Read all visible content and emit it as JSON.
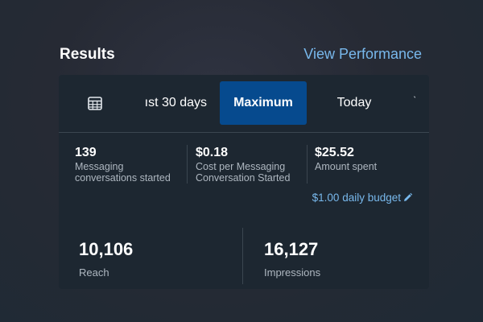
{
  "header": {
    "title": "Results",
    "link_label": "View Performance"
  },
  "tabs": {
    "calendar_icon": "calendar-icon",
    "items": [
      {
        "label": "ıst 30 days"
      },
      {
        "label": "Maximum",
        "selected": true
      },
      {
        "label": "Today"
      }
    ],
    "more_glyph": "ˋ"
  },
  "metrics": [
    {
      "value": "139",
      "label_line1": "Messaging",
      "label_line2": "conversations started"
    },
    {
      "value": "$0.18",
      "label_line1": "Cost per Messaging",
      "label_line2": "Conversation Started"
    },
    {
      "value": "$25.52",
      "label_line1": "Amount spent",
      "label_line2": ""
    }
  ],
  "budget": {
    "label": "$1.00 daily budget",
    "icon": "pencil-icon"
  },
  "big_metrics": [
    {
      "value": "10,106",
      "label": "Reach"
    },
    {
      "value": "16,127",
      "label": "Impressions"
    }
  ],
  "colors": {
    "accent_link": "#78b8ec",
    "selected_tab": "#064a8e",
    "card_background": "#1d2731"
  }
}
